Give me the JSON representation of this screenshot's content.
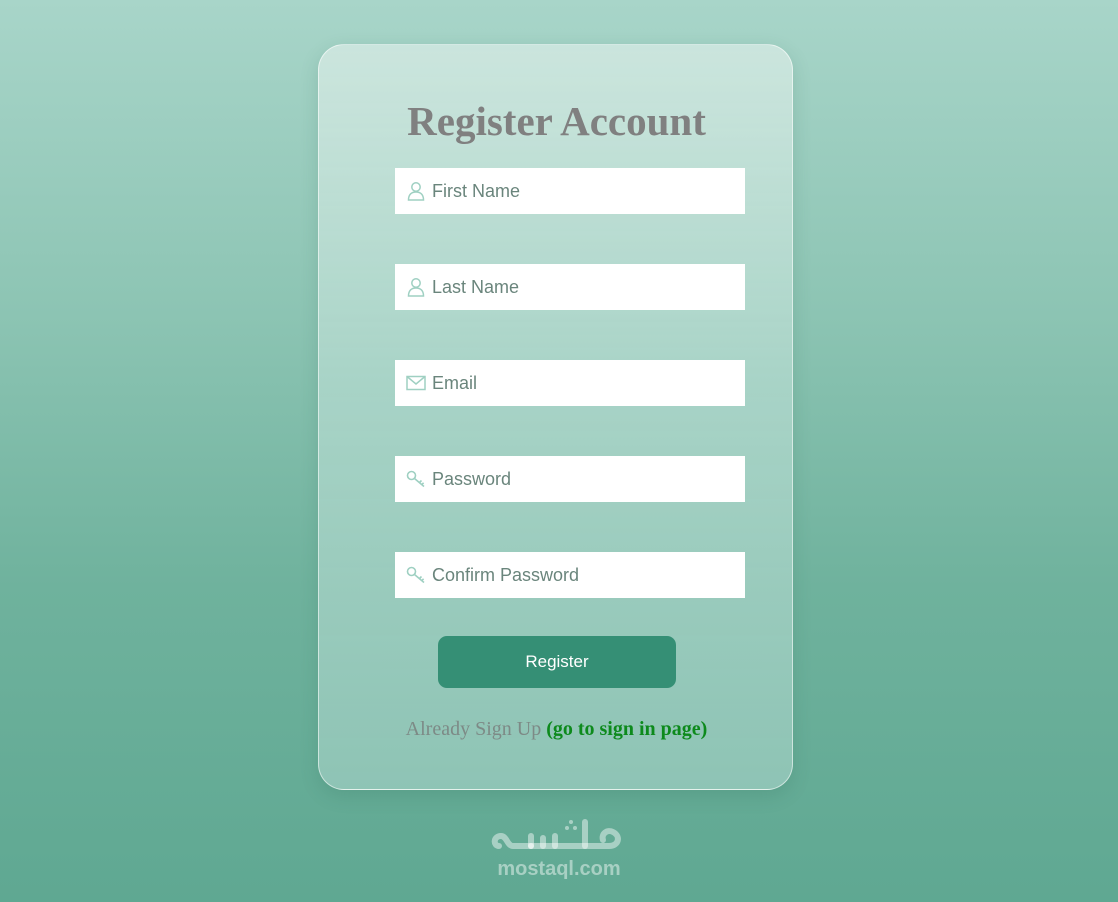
{
  "form": {
    "title": "Register Account",
    "fields": [
      {
        "icon": "user-icon",
        "placeholder": "First Name"
      },
      {
        "icon": "user-icon",
        "placeholder": "Last Name"
      },
      {
        "icon": "envelope-icon",
        "placeholder": "Email"
      },
      {
        "icon": "key-icon",
        "placeholder": "Password"
      },
      {
        "icon": "key-icon",
        "placeholder": "Confirm Password"
      }
    ],
    "submit_label": "Register",
    "signin_prompt": "Already Sign Up",
    "signin_link": "(go to sign in page)"
  },
  "watermark": {
    "logo_text": "مستقل",
    "site": "mostaql.com"
  },
  "colors": {
    "accent": "#358f75",
    "link": "#0d8a1c",
    "title": "#808080"
  }
}
